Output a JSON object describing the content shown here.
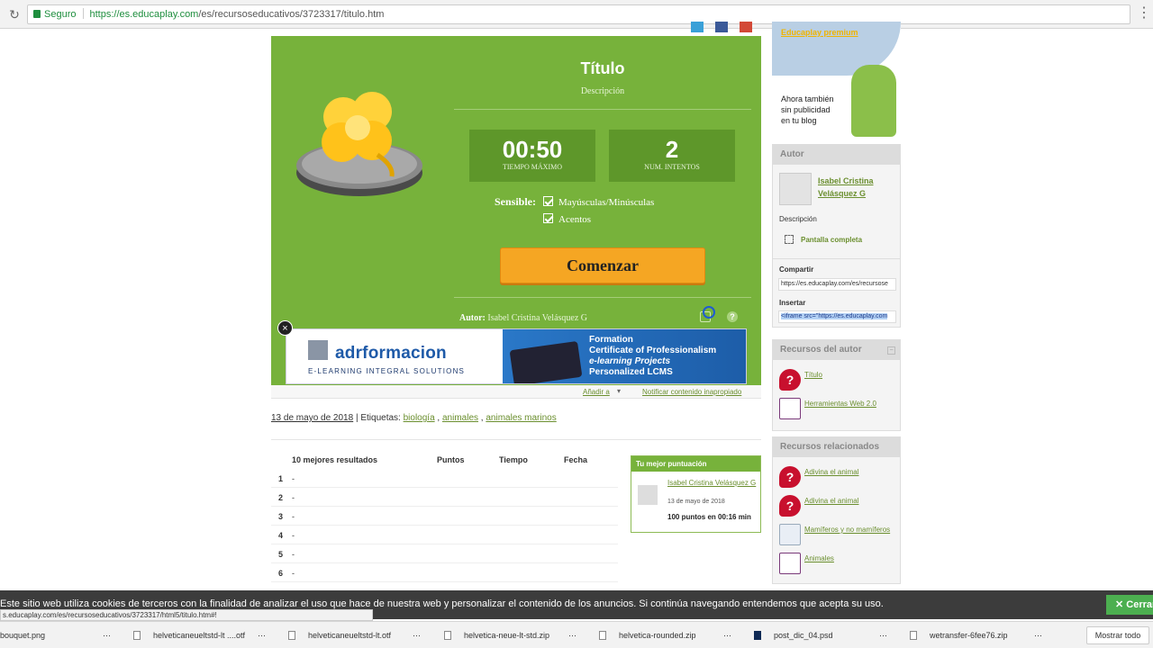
{
  "browser": {
    "secure_label": "Seguro",
    "url_host": "https://es.educaplay.com",
    "url_path": "/es/recursoseducativos/3723317/titulo.htm",
    "status_url": "s.educaplay.com/es/recursoseducativos/3723317/html5/titulo.htm#!"
  },
  "game": {
    "title": "Título",
    "description": "Descripción",
    "time_value": "00:50",
    "time_label": "TIEMPO MÁXIMO",
    "attempts_value": "2",
    "attempts_label": "NUM. INTENTOS",
    "sensible_label": "Sensible:",
    "checkbox_case": "Mayúsculas/Minúsculas",
    "checkbox_accents": "Acentos",
    "start_button": "Comenzar",
    "author_prefix": "Autor:",
    "author_name": "Isabel Cristina Velásquez G",
    "help": "?"
  },
  "ad": {
    "brand": "adrformacion",
    "tagline": "E-LEARNING   INTEGRAL   SOLUTIONS",
    "line1": "Formation",
    "line2": "Certificate of Professionalism",
    "line3": "e-learning Projects",
    "line4": "Personalized LCMS",
    "close": "×"
  },
  "actions": {
    "add_to": "Añadir a",
    "report": "Notificar contenido inapropiado"
  },
  "meta": {
    "date": "13 de mayo de 2018",
    "tags_label": "Etiquetas:",
    "tags": [
      "biología",
      "animales",
      "animales marinos"
    ]
  },
  "ranking": {
    "headers": [
      "10 mejores resultados",
      "Puntos",
      "Tiempo",
      "Fecha"
    ],
    "rows": [
      {
        "n": "1",
        "name": "-"
      },
      {
        "n": "2",
        "name": "-"
      },
      {
        "n": "3",
        "name": "-"
      },
      {
        "n": "4",
        "name": "-"
      },
      {
        "n": "5",
        "name": "-"
      },
      {
        "n": "6",
        "name": "-"
      }
    ]
  },
  "best_score": {
    "header": "Tu mejor puntuación",
    "name": "Isabel Cristina Velásquez G",
    "date": "13 de mayo de 2018",
    "score": "100 puntos en 00:16 min"
  },
  "premium": {
    "link": "Educaplay premium",
    "text_lines": [
      "Ahora también",
      "sin publicidad",
      "en tu blog"
    ]
  },
  "author_panel": {
    "header": "Autor",
    "name": "Isabel Cristina Velásquez G",
    "description": "Descripción",
    "fullscreen": "Pantalla completa",
    "share_label": "Compartir",
    "share_url": "https://es.educaplay.com/es/recursose",
    "embed_label": "Insertar",
    "embed_code": "<iframe src=\"https://es.educaplay.com"
  },
  "author_resources": {
    "header": "Recursos del autor",
    "items": [
      {
        "label": "Título",
        "icon": "question-icon"
      },
      {
        "label": "Herramientas Web 2.0",
        "icon": "crossword-icon"
      }
    ]
  },
  "related_resources": {
    "header": "Recursos relacionados",
    "items": [
      {
        "label": "Adivina el animal",
        "icon": "question-icon"
      },
      {
        "label": "Adivina el animal",
        "icon": "question-icon"
      },
      {
        "label": "Mamíferos y no mamíferos",
        "icon": "diagram-icon"
      },
      {
        "label": "Animales",
        "icon": "crossword-icon"
      }
    ]
  },
  "cookie": {
    "message": "Este sitio web utiliza cookies de terceros con la finalidad de analizar el uso que hace de nuestra web y personalizar el contenido de los anuncios. Si continúa navegando entendemos que acepta su uso.",
    "close": "Cerrar"
  },
  "downloads": {
    "items": [
      "bouquet.png",
      "helveticaneueltstd-lt ....otf",
      "helveticaneueltstd-lt.otf",
      "helvetica-neue-lt-std.zip",
      "helvetica-rounded.zip",
      "post_dic_04.psd",
      "wetransfer-6fee76.zip"
    ],
    "show_all": "Mostrar todo"
  }
}
